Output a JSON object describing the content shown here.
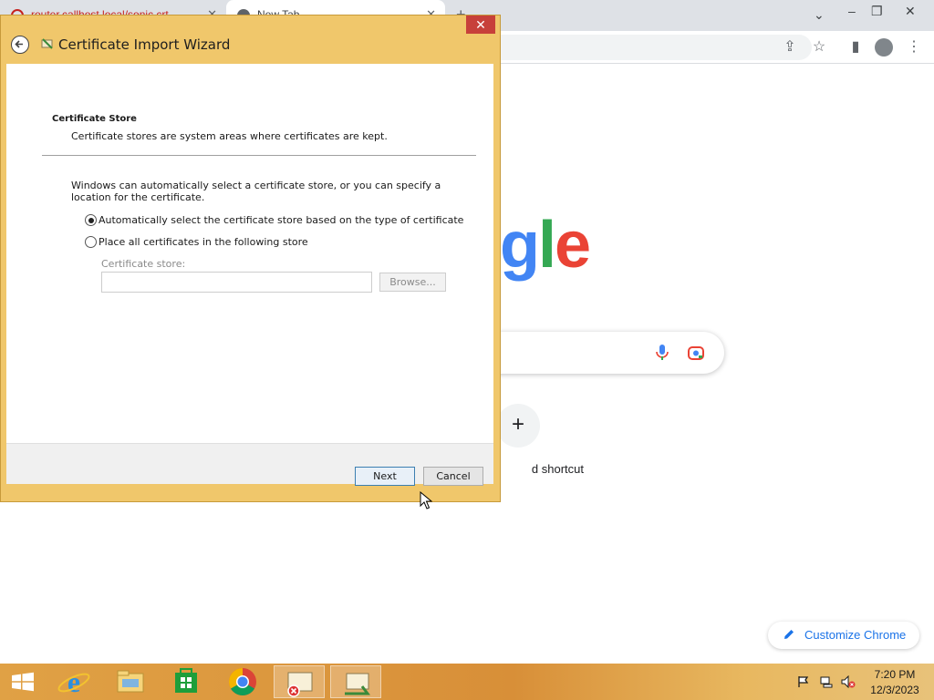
{
  "browser": {
    "tabs": [
      {
        "label": "router.callhost.local/sonic.crt"
      },
      {
        "label": "New Tab"
      }
    ],
    "newtab": {
      "logo_visible_text": [
        "g",
        "l",
        "e"
      ],
      "shortcut_label": "d shortcut",
      "shortcut_plus": "+",
      "customize_label": "Customize Chrome"
    }
  },
  "wizard": {
    "title": "Certificate Import Wizard",
    "close_glyph": "✕",
    "section_heading": "Certificate Store",
    "section_desc": "Certificate stores are system areas where certificates are kept.",
    "intro": "Windows can automatically select a certificate store, or you can specify a location for the certificate.",
    "option_auto": "Automatically select the certificate store based on the type of certificate",
    "option_place": "Place all certificates in the following store",
    "selected_option": "auto",
    "store_label": "Certificate store:",
    "store_value": "",
    "browse_label": "Browse...",
    "next_label": "Next",
    "cancel_label": "Cancel"
  },
  "taskbar": {
    "items": [
      "Internet Explorer",
      "File Explorer",
      "Store",
      "Google Chrome",
      "Certificate",
      "Certificate Import Wizard"
    ],
    "active_item": "Certificate Import Wizard",
    "clock_time": "7:20 PM",
    "clock_date": "12/3/2023"
  },
  "colors": {
    "dialog_frame": "#f0c76b",
    "close_button": "#c7403a",
    "taskbar": "#d88f38",
    "google_blue": "#4285f4",
    "google_green": "#34a853",
    "google_red": "#ea4335"
  }
}
